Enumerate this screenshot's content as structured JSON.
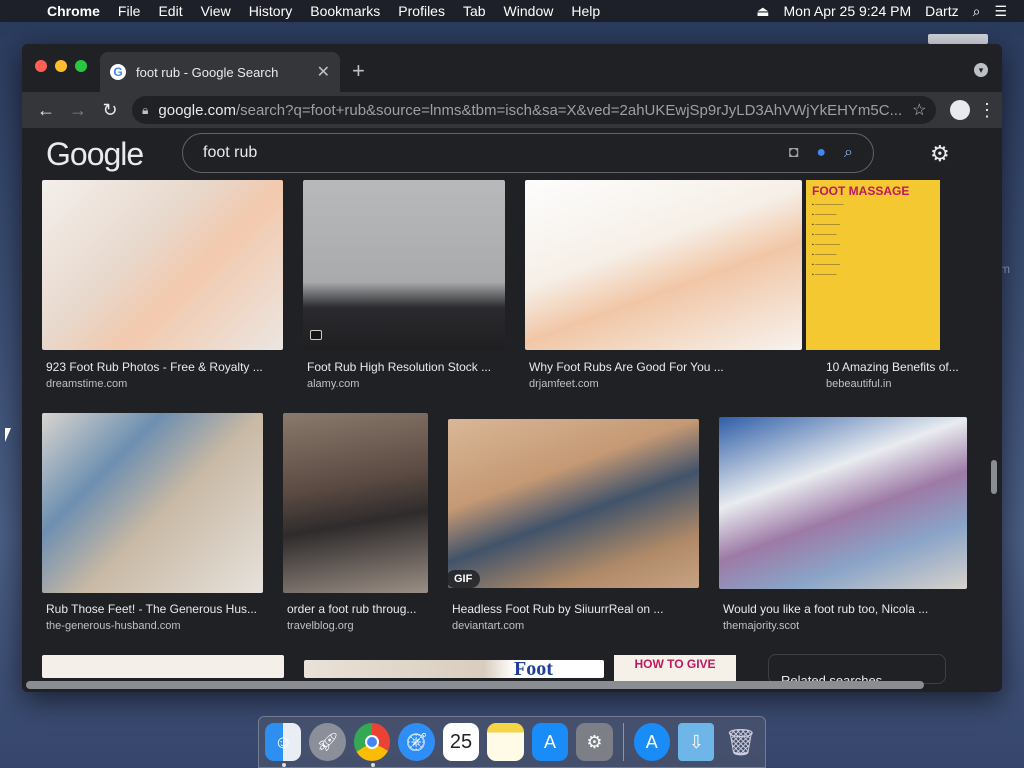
{
  "menubar": {
    "app": "Chrome",
    "items": [
      "File",
      "Edit",
      "View",
      "History",
      "Bookmarks",
      "Profiles",
      "Tab",
      "Window",
      "Help"
    ],
    "datetime": "Mon Apr 25  9:24 PM",
    "user": "Dartz"
  },
  "tab": {
    "title": "foot rub - Google Search"
  },
  "address": {
    "host": "google.com",
    "path": "/search?q=foot+rub&source=lnms&tbm=isch&sa=X&ved=2ahUKEwjSp9rJyLD3AhVWjYkEHYm5C..."
  },
  "google": {
    "logo": "Google",
    "query": "foot rub"
  },
  "results": [
    {
      "title": "923 Foot Rub Photos - Free & Royalty ...",
      "site": "dreamstime.com"
    },
    {
      "title": "Foot Rub High Resolution Stock ...",
      "site": "alamy.com"
    },
    {
      "title": "Why Foot Rubs Are Good For You ...",
      "site": "drjamfeet.com"
    },
    {
      "title": "10 Amazing Benefits of...",
      "site": "bebeautiful.in"
    },
    {
      "title": "Rub Those Feet! - The Generous Hus...",
      "site": "the-generous-husband.com"
    },
    {
      "title": "order a foot rub throug...",
      "site": "travelblog.org"
    },
    {
      "title": "Headless Foot Rub by SiiuurrReal on ...",
      "site": "deviantart.com"
    },
    {
      "title": "Would you like a foot rub too, Nicola ...",
      "site": "themajority.scot"
    }
  ],
  "badges": {
    "gif": "GIF"
  },
  "posters": {
    "massage_heading": "FOOT MASSAGE",
    "howto": "HOW TO GIVE",
    "foot_word": "Foot"
  },
  "related": "Related searches",
  "dock": {
    "calendar_day": "25"
  },
  "icons": [
    "apple-icon",
    "wifi-icon",
    "search-icon",
    "control-center-icon",
    "lock-icon",
    "star-icon",
    "camera-icon",
    "mic-icon",
    "gear-icon"
  ]
}
